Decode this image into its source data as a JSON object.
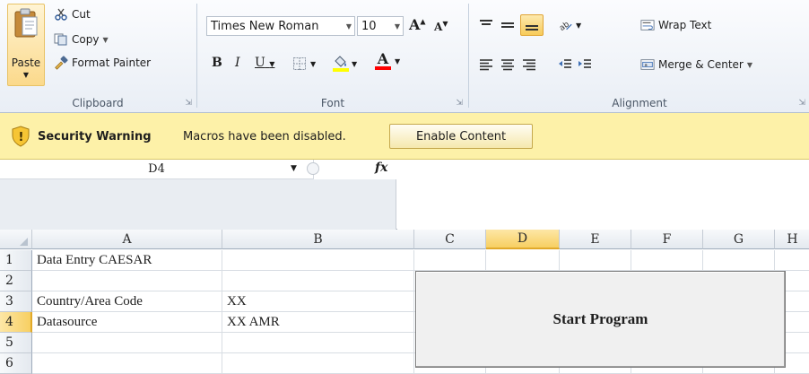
{
  "ribbon": {
    "clipboard": {
      "paste_label": "Paste",
      "cut_label": "Cut",
      "copy_label": "Copy",
      "format_painter_label": "Format Painter",
      "group_label": "Clipboard"
    },
    "font": {
      "font_name": "Times New Roman",
      "font_size": "10",
      "group_label": "Font",
      "bold": "B",
      "italic": "I",
      "underline": "U",
      "grow": "A",
      "shrink": "A",
      "font_color": "A",
      "highlight_color": "#ffff00",
      "font_color_value": "#ff0000"
    },
    "alignment": {
      "wrap_text_label": "Wrap Text",
      "merge_center_label": "Merge & Center",
      "group_label": "Alignment"
    }
  },
  "security_bar": {
    "title": "Security Warning",
    "message": "Macros have been disabled.",
    "enable_label": "Enable Content"
  },
  "formula_bar": {
    "name_box": "D4",
    "fx_label": "fx",
    "formula": ""
  },
  "grid": {
    "columns": [
      "A",
      "B",
      "C",
      "D",
      "E",
      "F",
      "G",
      "H"
    ],
    "rows": [
      "1",
      "2",
      "3",
      "4",
      "5",
      "6"
    ],
    "cells": {
      "A1": "Data Entry CAESAR",
      "A3": "Country/Area Code",
      "B3": "XX",
      "A4": "Datasource",
      "B4": "XX AMR"
    },
    "selected_cell": "D4"
  },
  "start_button": {
    "label": "Start Program"
  }
}
